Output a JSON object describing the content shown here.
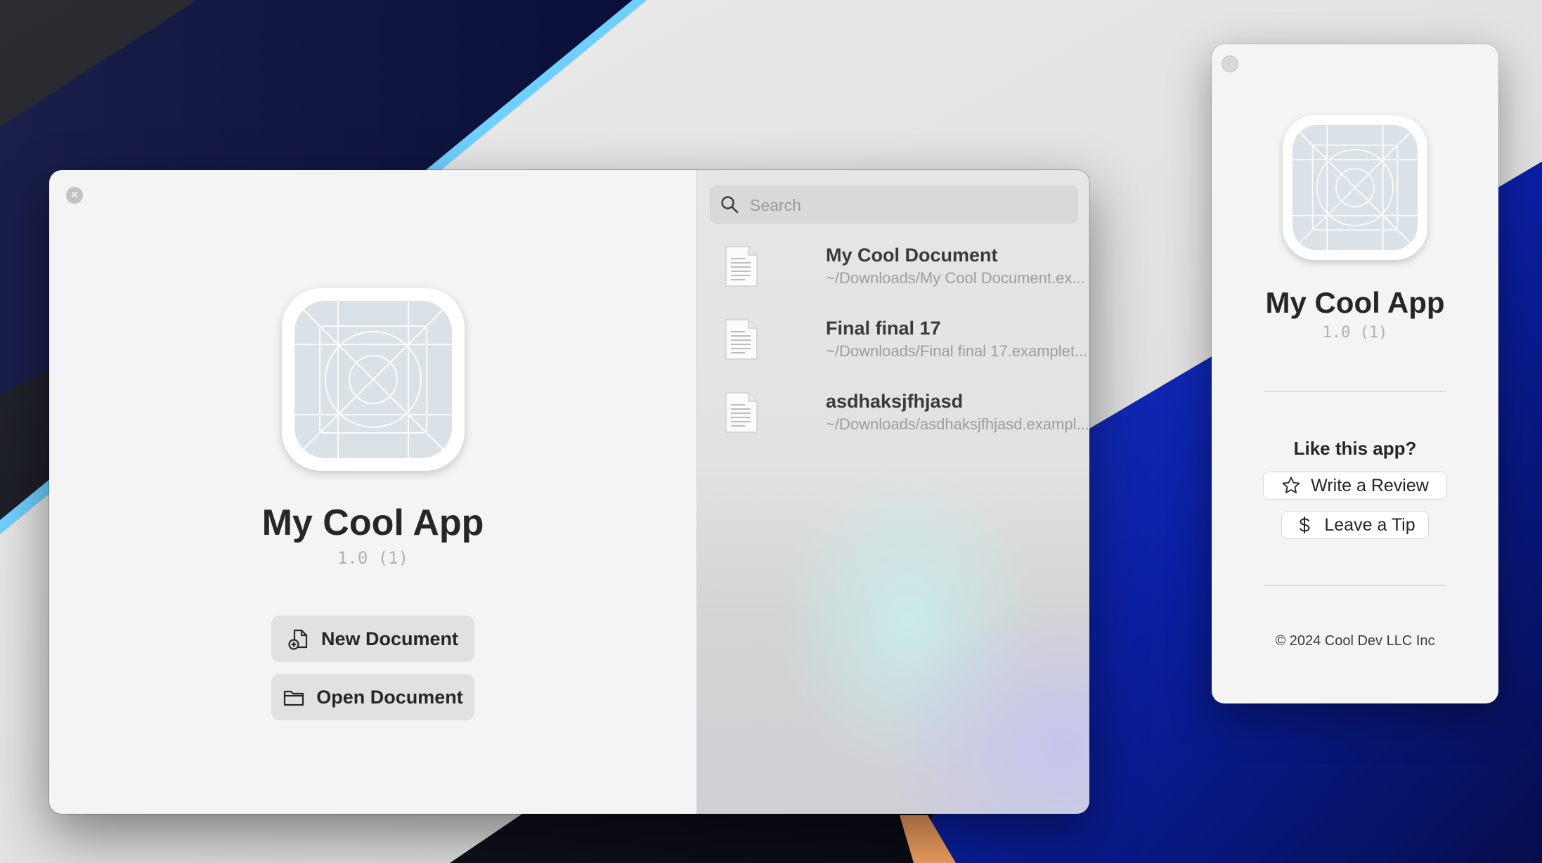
{
  "welcome_window": {
    "app_name": "My Cool App",
    "version": "1.0 (1)",
    "new_document_label": "New Document",
    "open_document_label": "Open Document",
    "search_placeholder": "Search",
    "recent_documents": [
      {
        "name": "My Cool Document",
        "path": "~/Downloads/My Cool Document.ex..."
      },
      {
        "name": "Final final 17",
        "path": "~/Downloads/Final final 17.examplet..."
      },
      {
        "name": "asdhaksjfhjasd",
        "path": "~/Downloads/asdhaksjfhjasd.exampl..."
      }
    ]
  },
  "about_window": {
    "app_name": "My Cool App",
    "version": "1.0 (1)",
    "like_prompt": "Like this app?",
    "write_review_label": "Write a Review",
    "leave_tip_label": "Leave a Tip",
    "copyright": "© 2024 Cool Dev LLC Inc"
  },
  "icons": {
    "close": "close-icon",
    "app": "app-icon-template-grid",
    "new_document": "document-plus-icon",
    "open_document": "folder-icon",
    "search": "magnifying-glass-icon",
    "document": "document-icon",
    "review": "star-icon",
    "tip": "dollar-icon"
  },
  "colors": {
    "window_bg": "#f4f4f4",
    "button_bg": "#e1e1e1",
    "title_text": "#262626",
    "secondary_text": "#9d9d9d",
    "icon_placeholder": "#dbe2e7"
  }
}
